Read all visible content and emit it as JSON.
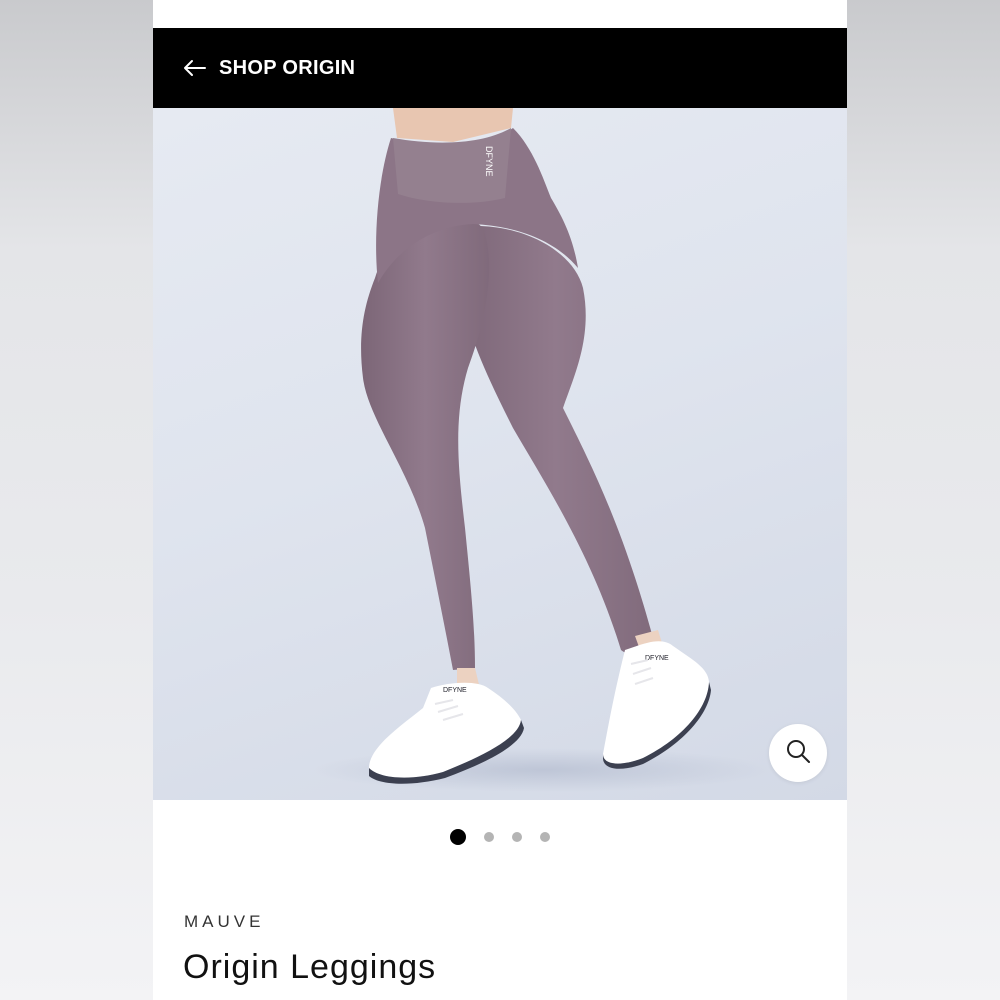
{
  "header": {
    "back_label": "SHOP ORIGIN",
    "back_icon": "arrow-left-icon",
    "background": "#000000"
  },
  "gallery": {
    "image_alt": "Model wearing mauve Origin Leggings with white sneakers",
    "waistband_logo": "DFYNE",
    "sneaker_logo": "DFYNE",
    "slide_count": 4,
    "active_slide": 1,
    "zoom_icon": "magnifier-icon"
  },
  "product": {
    "color": "MAUVE",
    "title": "Origin Leggings"
  },
  "colors": {
    "legging": "#8a7385",
    "background": "#dfe4ee",
    "accent": "#000000"
  }
}
